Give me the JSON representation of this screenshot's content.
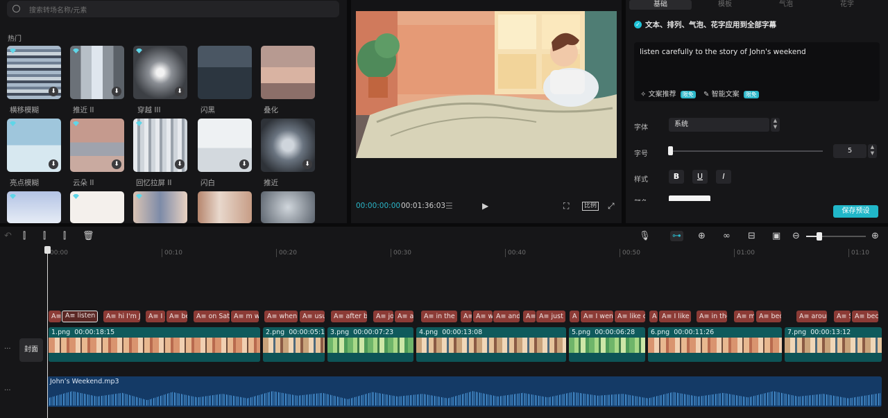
{
  "effects_panel": {
    "search_placeholder": "搜索转场名称/元素",
    "section_title": "热门",
    "tiles": [
      {
        "label": "横移模糊"
      },
      {
        "label": "推近 II"
      },
      {
        "label": "穿越 III"
      },
      {
        "label": "闪黑"
      },
      {
        "label": "叠化"
      },
      {
        "label": "亮点模糊"
      },
      {
        "label": "云朵 II"
      },
      {
        "label": "回忆拉屏 II"
      },
      {
        "label": "闪白"
      },
      {
        "label": "推近"
      }
    ]
  },
  "preview": {
    "current_time": "00:00:00:00",
    "total_time": "00:01:36:03",
    "ratio_label": "比例"
  },
  "text_panel": {
    "tabs": [
      "基础",
      "模板",
      "气泡",
      "花字"
    ],
    "apply_all_label": "文本、排列、气泡、花字应用到全部字幕",
    "text_value": "listen carefully to the story of John's weekend",
    "recommend_label": "文案推荐",
    "smart_label": "智能文案",
    "free_badge": "限免",
    "font_label": "字体",
    "font_value": "系统",
    "size_label": "字号",
    "size_value": "5",
    "style_label": "样式",
    "style_bold": "B",
    "style_underline": "U",
    "style_italic": "I",
    "color_label": "颜色",
    "save_preset": "保存预设"
  },
  "timeline": {
    "ruler": [
      "00:00",
      "00:10",
      "00:20",
      "00:30",
      "00:40",
      "00:50",
      "01:00",
      "01:10"
    ],
    "cover_label": "封面",
    "subtitles": [
      "listen c",
      "hi I'm Jo",
      "I a",
      "be",
      "on Satu",
      "m wh",
      "when I",
      "usu",
      "after br",
      "jo",
      "ar",
      "in the a",
      "w",
      "and",
      "just c",
      "I went",
      "like cl",
      "I like I",
      "in the",
      "my",
      "bec",
      "arour",
      "S",
      "bec"
    ],
    "clips": [
      {
        "name": "1.png",
        "duration": "00:00:18:15"
      },
      {
        "name": "2.png",
        "duration": "00:00:05:19"
      },
      {
        "name": "3.png",
        "duration": "00:00:07:23"
      },
      {
        "name": "4.png",
        "duration": "00:00:13:08"
      },
      {
        "name": "5.png",
        "duration": "00:00:06:28"
      },
      {
        "name": "6.png",
        "duration": "00:00:11:26"
      },
      {
        "name": "7.png",
        "duration": "00:00:13:12"
      }
    ],
    "audio_name": "John’s Weekend.mp3"
  },
  "colors": {
    "accent": "#21b7c9",
    "subtitle_clip": "#8c3b36",
    "video_clip": "#0f5a5c",
    "audio_clip": "#143a66"
  }
}
